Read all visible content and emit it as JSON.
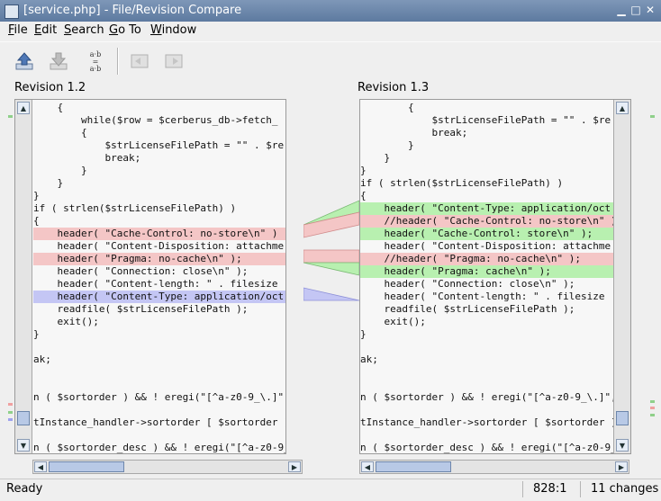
{
  "window": {
    "title": "[service.php] - File/Revision Compare"
  },
  "menu": [
    {
      "label": "File",
      "mnemonic": "F",
      "rest": "ile"
    },
    {
      "label": "Edit",
      "mnemonic": "E",
      "rest": "dit"
    },
    {
      "label": "Search",
      "mnemonic": "S",
      "rest": "earch"
    },
    {
      "label": "Go To",
      "mnemonic": "G",
      "rest": "o To"
    },
    {
      "label": "Window",
      "mnemonic": "W",
      "rest": "indow"
    }
  ],
  "toolbar": {
    "compare_label_top": "a·b",
    "compare_label_mid": "=",
    "compare_label_bot": "a·b"
  },
  "left": {
    "label": "Revision 1.2",
    "lines": [
      {
        "t": "    {",
        "k": ""
      },
      {
        "t": "        while($row = $cerberus_db->fetch_",
        "k": ""
      },
      {
        "t": "        {",
        "k": ""
      },
      {
        "t": "            $strLicenseFilePath = \"\" . $re",
        "k": ""
      },
      {
        "t": "            break;",
        "k": ""
      },
      {
        "t": "        }",
        "k": ""
      },
      {
        "t": "    }",
        "k": ""
      },
      {
        "t": "}",
        "k": ""
      },
      {
        "t": "if ( strlen($strLicenseFilePath) )",
        "k": ""
      },
      {
        "t": "{",
        "k": ""
      },
      {
        "t": "    header( \"Cache-Control: no-store\\n\" )",
        "k": "del"
      },
      {
        "t": "    header( \"Content-Disposition: attachme",
        "k": ""
      },
      {
        "t": "    header( \"Pragma: no-cache\\n\" );",
        "k": "del"
      },
      {
        "t": "    header( \"Connection: close\\n\" );",
        "k": ""
      },
      {
        "t": "    header( \"Content-length: \" . filesize",
        "k": ""
      },
      {
        "t": "    header( \"Content-Type: application/oct",
        "k": "chg"
      },
      {
        "t": "    readfile( $strLicenseFilePath );",
        "k": ""
      },
      {
        "t": "    exit();",
        "k": ""
      },
      {
        "t": "}",
        "k": ""
      },
      {
        "t": "",
        "k": ""
      },
      {
        "t": "ak;",
        "k": ""
      },
      {
        "t": "",
        "k": ""
      },
      {
        "t": "",
        "k": ""
      },
      {
        "t": "n ( $sortorder ) && ! eregi(\"[^a-z0-9_\\.]\",$",
        "k": ""
      },
      {
        "t": "",
        "k": ""
      },
      {
        "t": "tInstance_handler->sortorder [ $sortorder ]",
        "k": ""
      },
      {
        "t": "",
        "k": ""
      },
      {
        "t": "n ( $sortorder_desc ) && ! eregi(\"[^a-z0-9_\\",
        "k": ""
      }
    ]
  },
  "right": {
    "label": "Revision 1.3",
    "lines": [
      {
        "t": "        {",
        "k": ""
      },
      {
        "t": "            $strLicenseFilePath = \"\" . $re",
        "k": ""
      },
      {
        "t": "            break;",
        "k": ""
      },
      {
        "t": "        }",
        "k": ""
      },
      {
        "t": "    }",
        "k": ""
      },
      {
        "t": "}",
        "k": ""
      },
      {
        "t": "if ( strlen($strLicenseFilePath) )",
        "k": ""
      },
      {
        "t": "{",
        "k": ""
      },
      {
        "t": "    header( \"Content-Type: application/oct",
        "k": "add"
      },
      {
        "t": "    //header( \"Cache-Control: no-store\\n\" )",
        "k": "del"
      },
      {
        "t": "    header( \"Cache-Control: store\\n\" );",
        "k": "add"
      },
      {
        "t": "    header( \"Content-Disposition: attachme",
        "k": ""
      },
      {
        "t": "    //header( \"Pragma: no-cache\\n\" );",
        "k": "del"
      },
      {
        "t": "    header( \"Pragma: cache\\n\" );",
        "k": "add"
      },
      {
        "t": "    header( \"Connection: close\\n\" );",
        "k": ""
      },
      {
        "t": "    header( \"Content-length: \" . filesize",
        "k": ""
      },
      {
        "t": "    readfile( $strLicenseFilePath );",
        "k": ""
      },
      {
        "t": "    exit();",
        "k": ""
      },
      {
        "t": "}",
        "k": ""
      },
      {
        "t": "",
        "k": ""
      },
      {
        "t": "ak;",
        "k": ""
      },
      {
        "t": "",
        "k": ""
      },
      {
        "t": "",
        "k": ""
      },
      {
        "t": "n ( $sortorder ) && ! eregi(\"[^a-z0-9_\\.]\",$",
        "k": ""
      },
      {
        "t": "",
        "k": ""
      },
      {
        "t": "tInstance_handler->sortorder [ $sortorder ]",
        "k": ""
      },
      {
        "t": "",
        "k": ""
      },
      {
        "t": "n ( $sortorder_desc ) && ! eregi(\"[^a-z0-9_\\",
        "k": ""
      }
    ]
  },
  "status": {
    "text": "Ready",
    "position": "828:1",
    "changes": "11 changes"
  },
  "colors": {
    "added": "#b8f0b0",
    "deleted": "#f4c6c6",
    "changed": "#c4c6f4"
  }
}
